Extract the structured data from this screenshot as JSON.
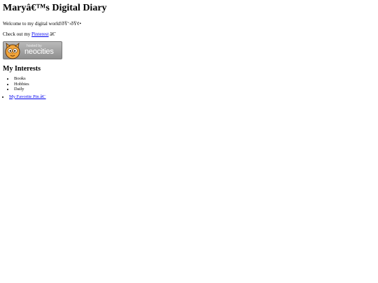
{
  "header": {
    "title": "Maryâ€™s Digital Diary"
  },
  "intro": {
    "welcome": "Welcome to my digital world!ðŸ‘‹ðŸ¢•",
    "pinterest_prefix": "Check out my ",
    "pinterest_link": "Pinterest",
    "pinterest_suffix": " â€¨"
  },
  "badge": {
    "hosted_by": "hosted by",
    "brand": "neocities",
    "icon": "neocities-cat-icon",
    "colors": {
      "background": "#9e9e9e",
      "text": "#ffffff"
    }
  },
  "interests": {
    "heading": "My Interests",
    "items": [
      "Books",
      "Hobbies",
      "Daily"
    ]
  },
  "pins": {
    "items": [
      {
        "label": "My Favorite Pin â€¨"
      }
    ]
  },
  "colors": {
    "link": "#0000ee",
    "text": "#000000",
    "background": "#ffffff"
  }
}
